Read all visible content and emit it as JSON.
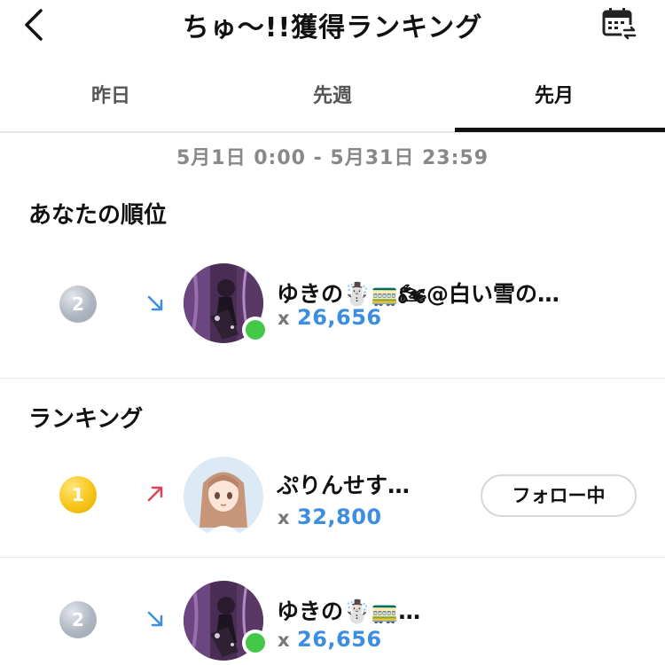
{
  "header": {
    "title": "ちゅ～!!獲得ランキング",
    "back_icon": "chevron-left-icon",
    "calendar_icon": "calendar-swap-icon"
  },
  "tabs": [
    {
      "label": "昨日",
      "active": false
    },
    {
      "label": "先週",
      "active": false
    },
    {
      "label": "先月",
      "active": true
    }
  ],
  "date_range": "5月1日 0:00 - 5月31日 23:59",
  "my_rank": {
    "section_title": "あなたの順位",
    "entry": {
      "rank": "2",
      "trend": "down",
      "name": "ゆきの☃️🚃🏍@白い雪の…",
      "x": "x",
      "count": "26,656",
      "online": true
    }
  },
  "ranking": {
    "section_title": "ランキング",
    "entries": [
      {
        "rank": "1",
        "trend": "up",
        "name": "ぷりんせす…",
        "x": "x",
        "count": "32,800",
        "online": false,
        "follow_label": "フォロー中"
      },
      {
        "rank": "2",
        "trend": "down",
        "name": "ゆきの☃️🚃…",
        "x": "x",
        "count": "26,656",
        "online": true
      }
    ]
  },
  "colors": {
    "accent_blue": "#3d8ee0",
    "online_green": "#43c84a",
    "trend_up": "#e0445a",
    "trend_down": "#3d8ee0"
  }
}
